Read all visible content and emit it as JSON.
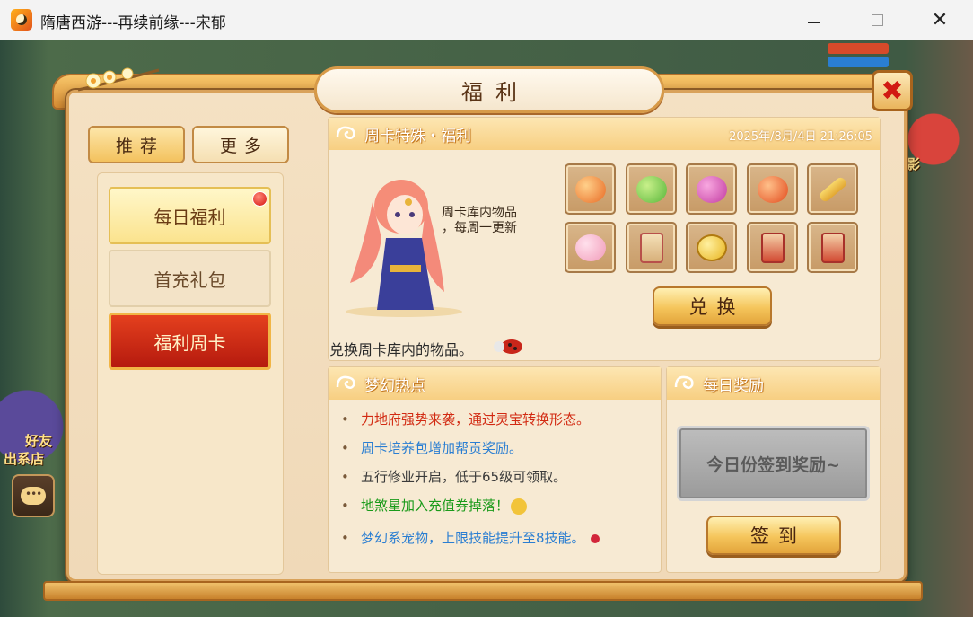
{
  "window": {
    "title": "隋唐西游---再续前缘---宋郁",
    "min_label": "",
    "max_label": "",
    "close_label": "✕"
  },
  "background": {
    "side_text_1": "影",
    "side_text_2": "好友",
    "side_text_3": "出系店"
  },
  "panel": {
    "title": "福利",
    "close_label": "✖"
  },
  "top_tabs": {
    "recommend": "推荐",
    "more": "更多"
  },
  "nav": {
    "items": [
      {
        "label": "每日福利",
        "state": "default",
        "has_red_dot": true
      },
      {
        "label": "首充礼包",
        "state": "default"
      },
      {
        "label": "福利周卡",
        "state": "selected"
      }
    ]
  },
  "weekly": {
    "header": "周卡特殊・福利",
    "timestamp": "2025年/8月/4日 21:26:05",
    "girl_text_line1": "周卡库内物品",
    "girl_text_line2": "，每周一更新",
    "items": [
      {
        "icon": "money-bag-icon",
        "color": "#e86a24"
      },
      {
        "icon": "green-pouch-icon",
        "color": "#58b63a"
      },
      {
        "icon": "jewel-box-icon",
        "color": "#c23aa0"
      },
      {
        "icon": "red-bag-icon",
        "color": "#e24a1c"
      },
      {
        "icon": "golden-key-icon",
        "color": "#e2a630"
      },
      {
        "icon": "pig-pet-icon",
        "color": "#f19ab8"
      },
      {
        "icon": "scroll-icon",
        "color": "#d8b07a"
      },
      {
        "icon": "gold-coin-icon",
        "color": "#e8b41e"
      },
      {
        "icon": "red-scroll-icon",
        "color": "#d24a32"
      },
      {
        "icon": "red-scroll-icon",
        "color": "#d24a32"
      }
    ],
    "exchange_button": "兑换",
    "note": "兑换周卡库内的物品。"
  },
  "hot_news": {
    "header": "梦幻热点",
    "items": [
      {
        "text": "力地府强势来袭，通过灵宝转换形态。",
        "color": "#d22a12"
      },
      {
        "text": "周卡培养包增加帮贡奖励。",
        "color": "#2a7ed2"
      },
      {
        "text": "五行修业开启，低于65级可领取。",
        "color": "#3a3a3a"
      },
      {
        "text": "地煞星加入充值券掉落！",
        "color": "#1a9a1a"
      },
      {
        "text": "梦幻系宠物，上限技能提升至8技能。",
        "color": "#2a7ed2"
      }
    ]
  },
  "daily_reward": {
    "header": "每日奖励",
    "plate_text": "今日份签到奖励~",
    "sign_button": "签到"
  },
  "colors": {
    "frame_gold": "#d9a25a",
    "selected_red": "#c8260e",
    "header_orange": "#f7cf82"
  }
}
